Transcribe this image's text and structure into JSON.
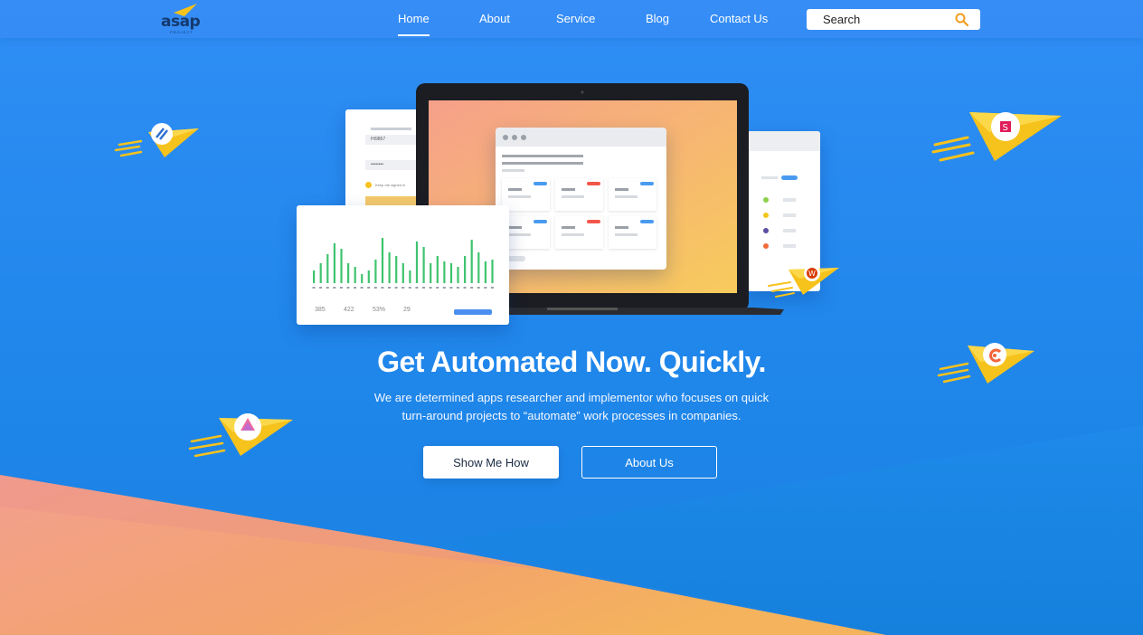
{
  "brand": {
    "logo_text": "asap",
    "logo_sub": "PROJECT",
    "logo_color": "#143a6e"
  },
  "nav": {
    "items": [
      {
        "label": "Home",
        "active": true
      },
      {
        "label": "About",
        "active": false
      },
      {
        "label": "Service",
        "active": false
      },
      {
        "label": "Blog",
        "active": false
      },
      {
        "label": "Contact Us",
        "active": false
      }
    ],
    "search_label": "Search",
    "search_icon": "search-icon",
    "search_icon_color": "#f29d1f"
  },
  "hero": {
    "title": "Get Automated Now. Quickly.",
    "subtitle_line1": "We are determined apps researcher and implementor who focuses on quick",
    "subtitle_line2": "turn-around projects to “automate” work processes in companies.",
    "primary_button": "Show Me How",
    "secondary_button": "About Us"
  },
  "mockup": {
    "login_card": {
      "field1_value": "HI9867",
      "password_mask": "••••••••",
      "remember": "Keep me signed in"
    },
    "chart_card": {
      "stats": [
        "385",
        "422",
        "53%",
        "29"
      ]
    }
  },
  "planes": [
    {
      "icon": "wordpress-icon"
    },
    {
      "icon": "slack-icon"
    },
    {
      "icon": "office-icon"
    },
    {
      "icon": "creative-cloud-icon"
    },
    {
      "icon": "asana-icon"
    }
  ],
  "colors": {
    "background": "#2f8ef5",
    "accent_yellow": "#f6c21c",
    "accent_orange": "#f6a07a",
    "chart_green": "#3fc36f"
  }
}
